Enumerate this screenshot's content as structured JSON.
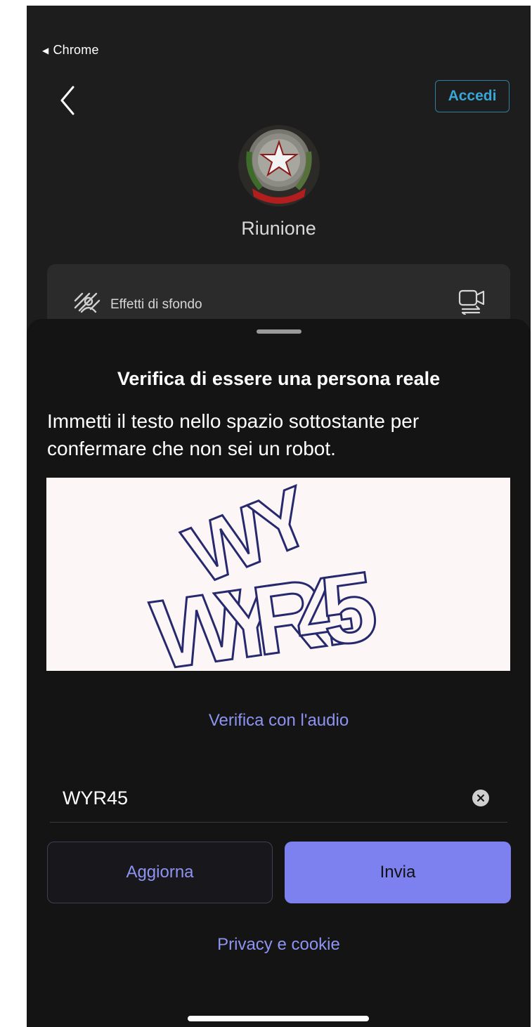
{
  "status_bar": {
    "back_to_app": "Chrome",
    "back_icon": "triangle-left-icon"
  },
  "header": {
    "back_icon": "chevron-left-icon",
    "signin_label": "Accedi"
  },
  "meeting": {
    "title": "Riunione",
    "logo": "italian-republic-emblem"
  },
  "background_card": {
    "effects_label": "Effetti di sfondo",
    "effects_icon": "background-effects-icon",
    "camera_icon": "camera-switch-icon"
  },
  "sheet": {
    "title": "Verifica di essere una persona reale",
    "description": "Immetti il testo nello spazio sottostante per confermare che non sei un robot.",
    "captcha_text": "WYR45",
    "audio_link": "Verifica con l'audio",
    "answer_value": "WYR45",
    "refresh_label": "Aggiorna",
    "submit_label": "Invia",
    "privacy_link": "Privacy e cookie"
  },
  "colors": {
    "accent": "#7d81f0",
    "link": "#8e93f2",
    "signin": "#38a6d6",
    "sheet_bg": "#141414"
  }
}
